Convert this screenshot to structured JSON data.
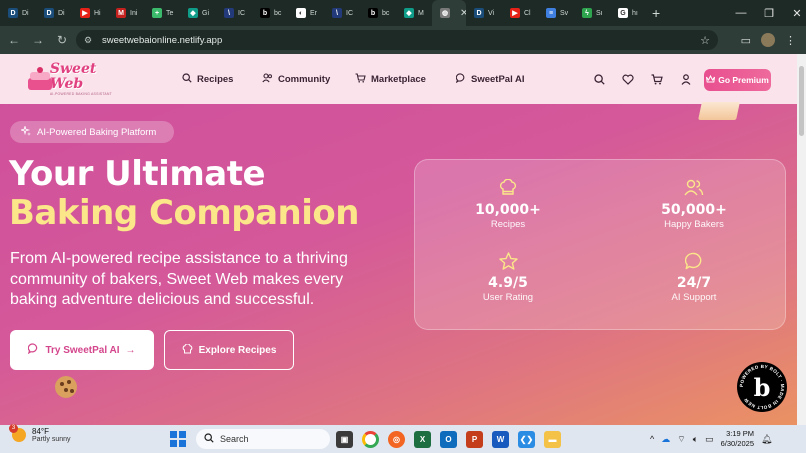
{
  "browser": {
    "tabs": [
      {
        "label": "Di",
        "fav_color": "#1a4d7a",
        "fav_glyph": "D"
      },
      {
        "label": "Di",
        "fav_color": "#1a4d7a",
        "fav_glyph": "D"
      },
      {
        "label": "Hi",
        "fav_color": "#e62117",
        "fav_glyph": "▶"
      },
      {
        "label": "Ini",
        "fav_color": "#c5221f",
        "fav_glyph": "M"
      },
      {
        "label": "Te",
        "fav_color": "#3cba6b",
        "fav_glyph": "+"
      },
      {
        "label": "Gi",
        "fav_color": "#0f9d8a",
        "fav_glyph": "◆"
      },
      {
        "label": "IC",
        "fav_color": "#223a7a",
        "fav_glyph": "\\"
      },
      {
        "label": "bc",
        "fav_color": "#000000",
        "fav_glyph": "b"
      },
      {
        "label": "Er",
        "fav_color": "#ffffff",
        "fav_glyph": "◐"
      },
      {
        "label": "IC",
        "fav_color": "#223a7a",
        "fav_glyph": "\\"
      },
      {
        "label": "bc",
        "fav_color": "#000000",
        "fav_glyph": "b"
      },
      {
        "label": "M",
        "fav_color": "#0f9d8a",
        "fav_glyph": "◆"
      },
      {
        "label": "",
        "fav_color": "#7a7a7a",
        "fav_glyph": "◍",
        "active": true
      },
      {
        "label": "Vi",
        "fav_color": "#1a4d7a",
        "fav_glyph": "D"
      },
      {
        "label": "Cl",
        "fav_color": "#e62117",
        "fav_glyph": "▶"
      },
      {
        "label": "Sv",
        "fav_color": "#3f7fe0",
        "fav_glyph": "≡"
      },
      {
        "label": "Sı",
        "fav_color": "#2ea44f",
        "fav_glyph": "ϟ"
      },
      {
        "label": "hı",
        "fav_color": "#ffffff",
        "fav_glyph": "G"
      }
    ],
    "url": "sweetwebaionline.netlify.app"
  },
  "site": {
    "logo_name": "Sweet Web",
    "logo_tagline": "AI-POWERED BAKING ASSISTANT",
    "nav": [
      {
        "label": "Recipes",
        "icon": "search-icon"
      },
      {
        "label": "Community",
        "icon": "users-icon"
      },
      {
        "label": "Marketplace",
        "icon": "cart-icon"
      },
      {
        "label": "SweetPal AI",
        "icon": "chat-icon"
      }
    ],
    "premium_label": "Go Premium"
  },
  "hero": {
    "badge": "AI-Powered Baking Platform",
    "title_line1": "Your Ultimate",
    "title_line2": "Baking Companion",
    "subtitle": "From AI-powered recipe assistance to a thriving community of bakers, Sweet Web makes every baking adventure delicious and successful.",
    "primary_button": "Try SweetPal AI",
    "secondary_button": "Explore Recipes"
  },
  "stats": [
    {
      "value": "10,000+",
      "label": "Recipes",
      "icon": "chef-hat-icon"
    },
    {
      "value": "50,000+",
      "label": "Happy Bakers",
      "icon": "users-icon"
    },
    {
      "value": "4.9/5",
      "label": "User Rating",
      "icon": "star-icon"
    },
    {
      "value": "24/7",
      "label": "AI Support",
      "icon": "chat-icon"
    }
  ],
  "bolt_badge": "POWERED BY BOLT · MADE IN BOLT NEW",
  "taskbar": {
    "weather_temp": "84°F",
    "weather_desc": "Partly sunny",
    "weather_alerts": "3",
    "search_placeholder": "Search",
    "time": "3:19 PM",
    "date": "6/30/2025"
  },
  "colors": {
    "accent_pink": "#e84f8f",
    "hero_yellow": "#fbe78a",
    "header_bg": "#fbe3ec"
  }
}
